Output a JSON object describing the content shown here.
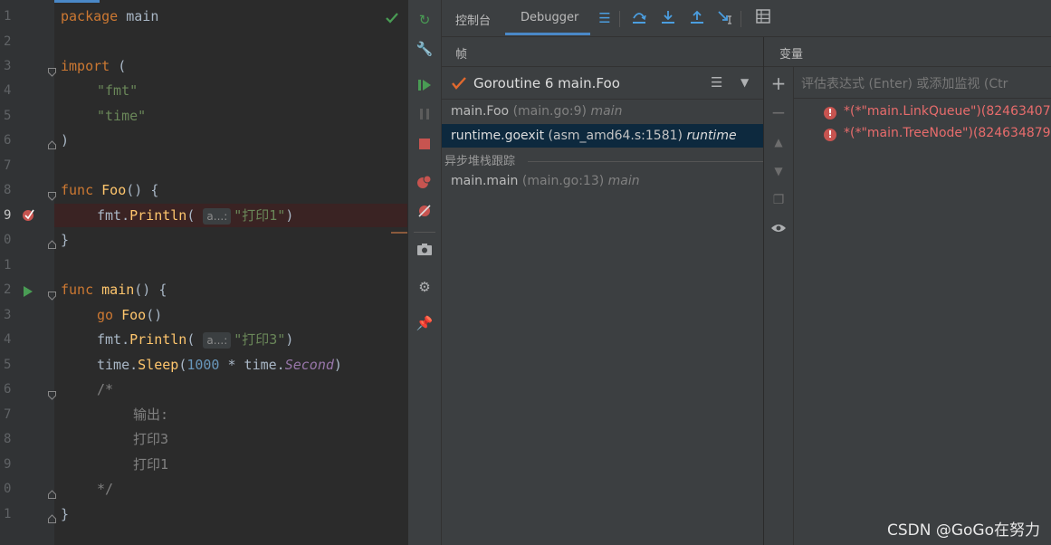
{
  "editor": {
    "lines": [
      {
        "n": "1",
        "code": "package main"
      },
      {
        "n": "2",
        "code": ""
      },
      {
        "n": "3",
        "code": "import ("
      },
      {
        "n": "4",
        "code": "\"fmt\""
      },
      {
        "n": "5",
        "code": "\"time\""
      },
      {
        "n": "6",
        "code": ")"
      },
      {
        "n": "7",
        "code": ""
      },
      {
        "n": "8",
        "code": "func Foo() {"
      },
      {
        "n": "9",
        "code": "fmt.Println( a...: \"打印1\")"
      },
      {
        "n": "0",
        "code": "}"
      },
      {
        "n": "1",
        "code": ""
      },
      {
        "n": "2",
        "code": "func main() {"
      },
      {
        "n": "3",
        "code": "go Foo()"
      },
      {
        "n": "4",
        "code": "fmt.Println( a...: \"打印3\")"
      },
      {
        "n": "5",
        "code": "time.Sleep(1000 * time.Second)"
      },
      {
        "n": "6",
        "code": "/*"
      },
      {
        "n": "7",
        "code": "输出:"
      },
      {
        "n": "8",
        "code": "打印3"
      },
      {
        "n": "9",
        "code": "打印1"
      },
      {
        "n": "0",
        "code": "*/"
      },
      {
        "n": "1",
        "code": "}"
      }
    ],
    "hint_label": "a...:"
  },
  "debug": {
    "tab_console": "控制台",
    "tab_debugger": "Debugger",
    "frames_header": "帧",
    "variables_header": "变量",
    "goroutine_label": "Goroutine 6 main.Foo",
    "frames": [
      {
        "func": "main.Foo",
        "loc": "(main.go:9)",
        "pkg": "main"
      },
      {
        "func": "runtime.goexit",
        "loc": "(asm_amd64.s:1581)",
        "pkg": "runtime"
      }
    ],
    "async_label": "异步堆栈跟踪",
    "async_frames": [
      {
        "func": "main.main",
        "loc": "(main.go:13)",
        "pkg": "main"
      }
    ],
    "eval_placeholder": "评估表达式 (Enter) 或添加监视 (Ctr",
    "variables": [
      {
        "text": "*(*\"main.LinkQueue\")(82463407"
      },
      {
        "text": "*(*\"main.TreeNode\")(824634879"
      }
    ]
  },
  "watermark": "CSDN @GoGo在努力"
}
